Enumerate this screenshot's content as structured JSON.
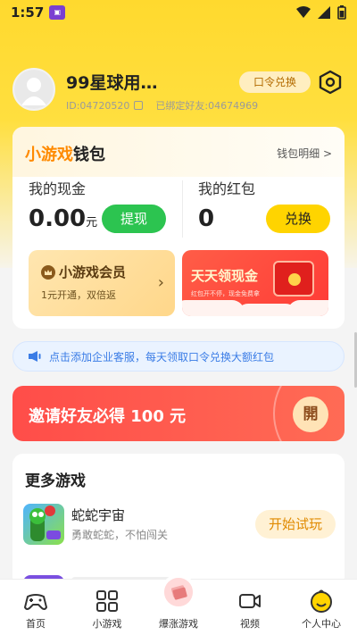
{
  "status_bar": {
    "time": "1:57"
  },
  "profile": {
    "username": "99星球用…",
    "user_id": "ID:04720520",
    "bound_friend": "已绑定好友:04674969",
    "redeem_label": "口令兑换"
  },
  "wallet": {
    "title_highlight": "小游戏",
    "title_rest": "钱包",
    "detail_link": "钱包明细 >",
    "cash_label": "我的现金",
    "cash_value": "0.00",
    "cash_unit": "元",
    "withdraw_label": "提现",
    "red_label": "我的红包",
    "red_value": "0",
    "exchange_label": "兑换",
    "vip_title": "小游戏会员",
    "vip_sub": "1元开通，双倍返",
    "cash_card_title": "天天领现金",
    "cash_card_sub": "红包开不停，现金免费拿"
  },
  "notice": {
    "text": "点击添加企业客服，每天领取口令兑换大额红包"
  },
  "invite": {
    "text": "邀请好友必得 100 元",
    "button": "開"
  },
  "more_games": {
    "title": "更多游戏",
    "items": [
      {
        "name": "蛇蛇宇宙",
        "desc": "勇敢蛇蛇，不怕闯关",
        "button": "开始试玩"
      }
    ]
  },
  "tabbar": {
    "items": [
      {
        "label": "首页",
        "icon": "gamepad-icon"
      },
      {
        "label": "小游戏",
        "icon": "grid-icon"
      },
      {
        "label": "爆涨游戏",
        "icon": "money-icon"
      },
      {
        "label": "视频",
        "icon": "video-icon"
      },
      {
        "label": "个人中心",
        "icon": "smile-icon"
      }
    ]
  },
  "colors": {
    "brand_yellow": "#ffd92e",
    "accent_orange": "#ff8a00",
    "green": "#2cc450",
    "red": "#ff4d49"
  }
}
